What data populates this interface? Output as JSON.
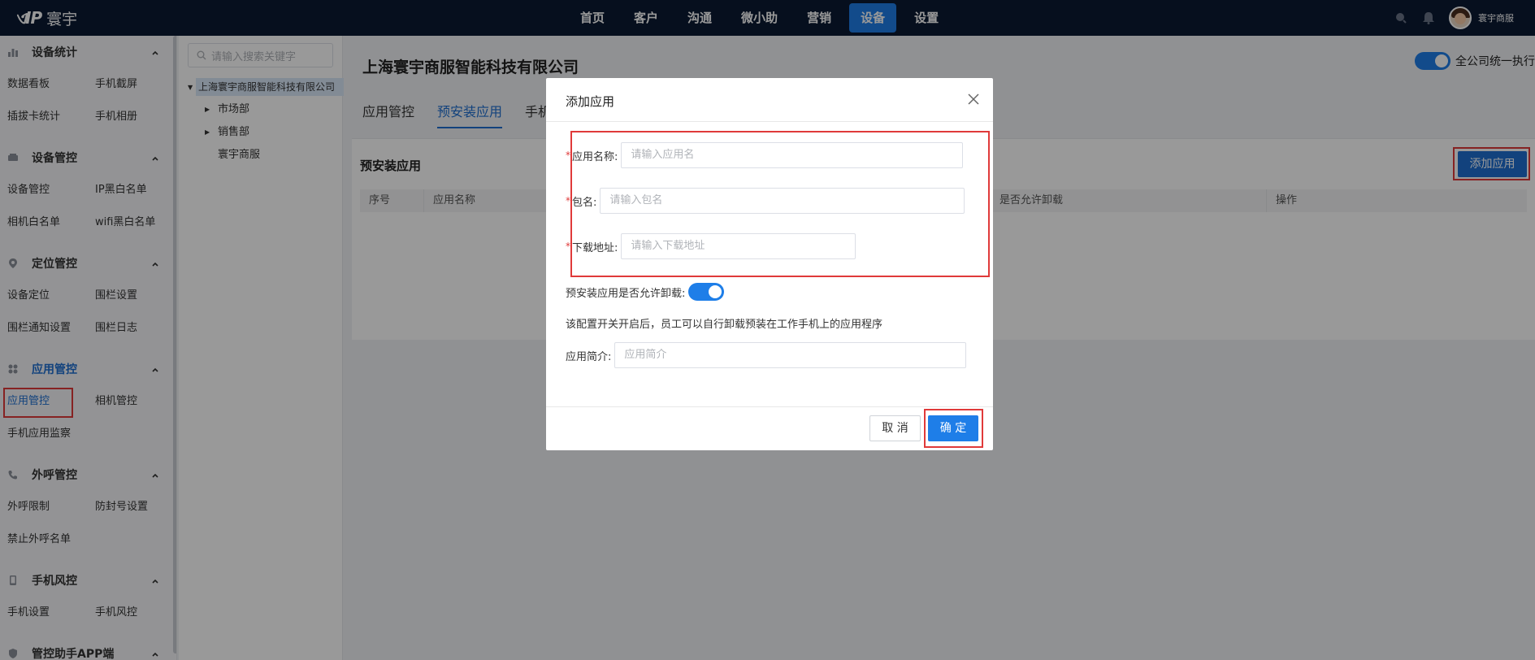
{
  "header": {
    "logo_mark": "ଏIP",
    "logo_text": "寰宇",
    "nav": [
      "首页",
      "客户",
      "沟通",
      "微小助",
      "营销",
      "设备",
      "设置"
    ],
    "nav_active_index": 5,
    "user_name": "寰宇商服"
  },
  "sidebar": {
    "groups": [
      {
        "title": "设备统计",
        "icon": "bar-chart-icon",
        "items": [
          "数据看板",
          "手机截屏",
          "插拔卡统计",
          "手机相册"
        ]
      },
      {
        "title": "设备管控",
        "icon": "device-icon",
        "items": [
          "设备管控",
          "IP黑白名单",
          "相机白名单",
          "wifi黑白名单"
        ]
      },
      {
        "title": "定位管控",
        "icon": "location-icon",
        "items": [
          "设备定位",
          "围栏设置",
          "围栏通知设置",
          "围栏日志"
        ]
      },
      {
        "title": "应用管控",
        "icon": "apps-icon",
        "items": [
          "应用管控",
          "相机管控",
          "手机应用监察"
        ],
        "active": true,
        "active_item": "应用管控"
      },
      {
        "title": "外呼管控",
        "icon": "phone-icon",
        "items": [
          "外呼限制",
          "防封号设置",
          "禁止外呼名单"
        ]
      },
      {
        "title": "手机风控",
        "icon": "phone-risk-icon",
        "items": [
          "手机设置",
          "手机风控"
        ]
      },
      {
        "title": "管控助手APP端",
        "icon": "assistant-icon",
        "items": []
      }
    ]
  },
  "tree": {
    "search_placeholder": "请输入搜索关键字",
    "root": "上海寰宇商服智能科技有限公司",
    "children": [
      "市场部",
      "销售部",
      "寰宇商服"
    ]
  },
  "main": {
    "company": "上海寰宇商服智能科技有限公司",
    "global_toggle_label": "全公司统一执行",
    "tabs": [
      "应用管控",
      "预安装应用",
      "手机"
    ],
    "active_tab": 1,
    "card_title": "预安装应用",
    "add_button": "添加应用",
    "table_headers": [
      "序号",
      "应用名称",
      "是否允许卸载",
      "操作"
    ]
  },
  "modal": {
    "title": "添加应用",
    "fields": {
      "name_label": "应用名称:",
      "name_placeholder": "请输入应用名",
      "package_label": "包名:",
      "package_placeholder": "请输入包名",
      "url_label": "下载地址:",
      "url_placeholder": "请输入下载地址",
      "uninstall_label": "预安装应用是否允许卸载:",
      "uninstall_on": true,
      "note": "该配置开关开启后，员工可以自行卸载预装在工作手机上的应用程序",
      "intro_label": "应用简介:",
      "intro_placeholder": "应用简介"
    },
    "cancel": "取 消",
    "ok": "确 定"
  },
  "colors": {
    "topbar": "#0b1a33",
    "accent": "#1e7ee8",
    "highlight": "#e03a3a"
  }
}
